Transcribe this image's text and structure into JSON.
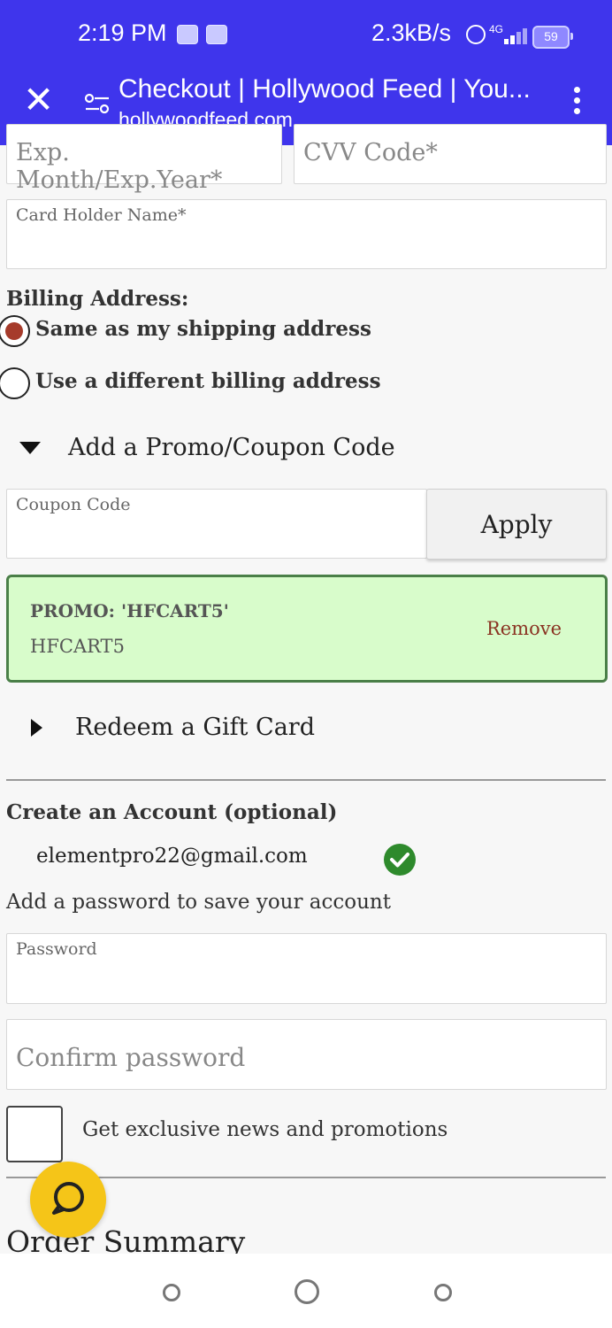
{
  "status_bar": {
    "time": "2:19 PM",
    "net_speed": "2.3kB/s",
    "network_type": "4G",
    "battery": "59"
  },
  "browser": {
    "page_title": "Checkout | Hollywood Feed | You...",
    "url": "hollywoodfeed.com"
  },
  "payment": {
    "exp_label": "Exp. Month/Exp.Year*",
    "cvv_label": "CVV Code*",
    "card_holder_label": "Card Holder Name*"
  },
  "billing": {
    "heading": "Billing Address:",
    "options": [
      {
        "label": "Same as my shipping address",
        "selected": true
      },
      {
        "label": "Use a different billing address",
        "selected": false
      }
    ]
  },
  "promo": {
    "toggle_label": "Add a Promo/Coupon Code",
    "coupon_label": "Coupon Code",
    "apply_label": "Apply",
    "applied_title": "PROMO: 'HFCART5'",
    "applied_code": "HFCART5",
    "remove_label": "Remove"
  },
  "gift_card": {
    "toggle_label": "Redeem a Gift Card"
  },
  "account": {
    "heading": "Create an Account (optional)",
    "email": "elementpro22@gmail.com",
    "password_prompt": "Add a password to save your account",
    "password_label": "Password",
    "confirm_label": "Confirm password",
    "newsletter_label": "Get exclusive news and promotions"
  },
  "order_summary": {
    "heading": "Order Summary"
  },
  "colors": {
    "header_bg": "#3f35ec",
    "promo_bg": "#d8fccb",
    "promo_border": "#4a7f48",
    "remove_text": "#8a3322",
    "chat_button": "#f5c518",
    "verified_green": "#2e8a2c",
    "radio_selected": "#a63b2b"
  }
}
